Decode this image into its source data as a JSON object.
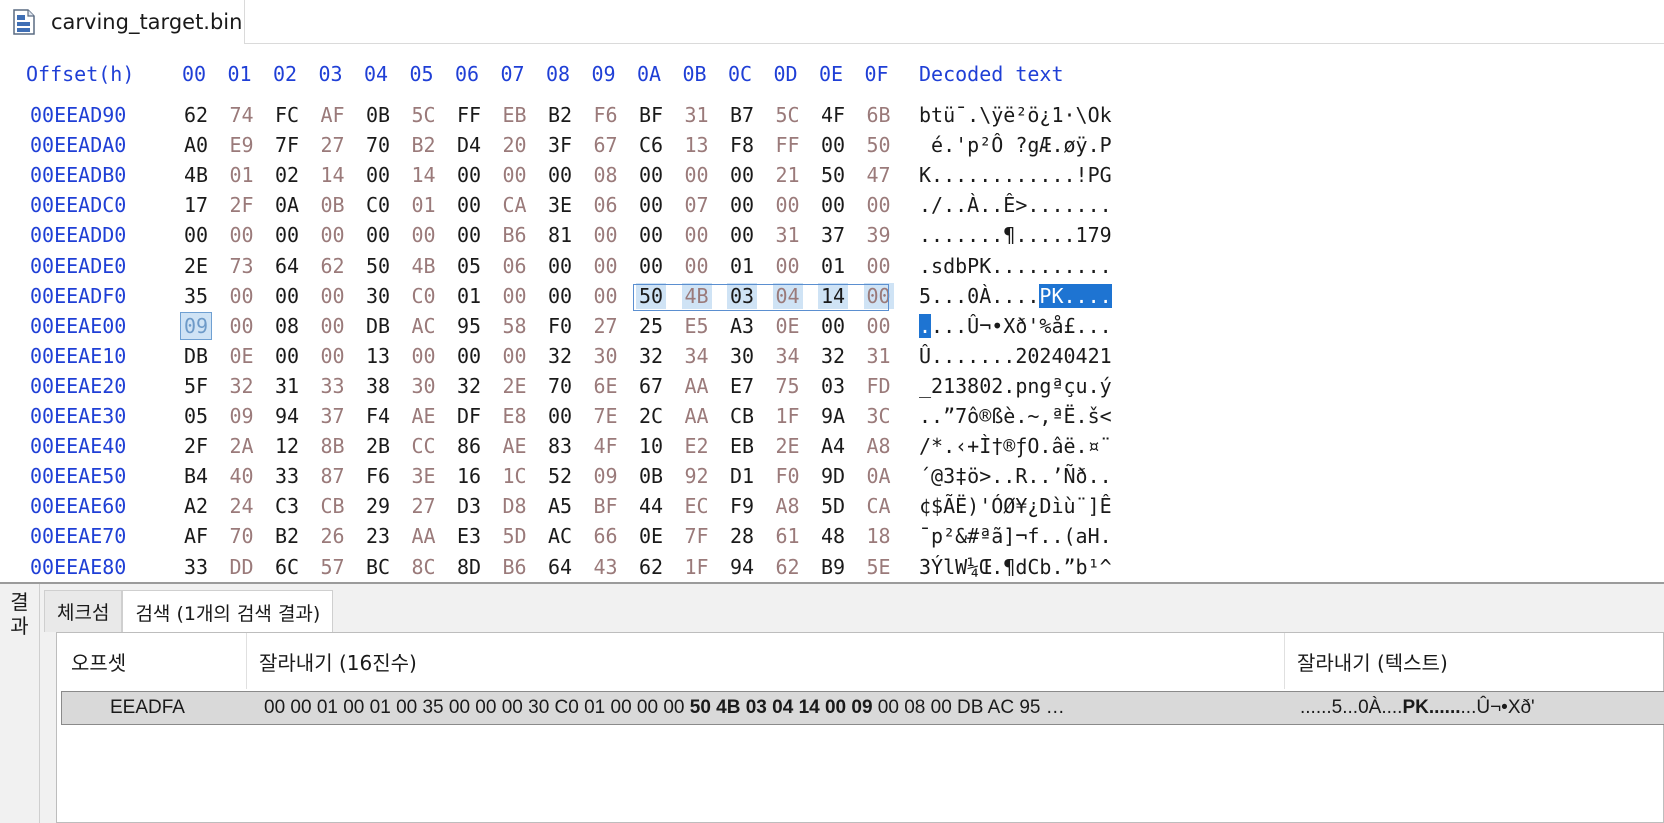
{
  "tab": {
    "filename": "carving_target.bin"
  },
  "hex": {
    "offset_header": "Offset(h)",
    "column_headers": [
      "00",
      "01",
      "02",
      "03",
      "04",
      "05",
      "06",
      "07",
      "08",
      "09",
      "0A",
      "0B",
      "0C",
      "0D",
      "0E",
      "0F"
    ],
    "decoded_header": "Decoded text",
    "rows": [
      {
        "offset": "00EEAD90",
        "bytes": [
          "62",
          "74",
          "FC",
          "AF",
          "0B",
          "5C",
          "FF",
          "EB",
          "B2",
          "F6",
          "BF",
          "31",
          "B7",
          "5C",
          "4F",
          "6B"
        ],
        "decoded": "btü¯.\\ÿë²ö¿1·\\Ok"
      },
      {
        "offset": "00EEADA0",
        "bytes": [
          "A0",
          "E9",
          "7F",
          "27",
          "70",
          "B2",
          "D4",
          "20",
          "3F",
          "67",
          "C6",
          "13",
          "F8",
          "FF",
          "00",
          "50"
        ],
        "decoded": " é.'p²Ô ?gÆ.øÿ.P"
      },
      {
        "offset": "00EEADB0",
        "bytes": [
          "4B",
          "01",
          "02",
          "14",
          "00",
          "14",
          "00",
          "00",
          "00",
          "08",
          "00",
          "00",
          "00",
          "21",
          "50",
          "47"
        ],
        "decoded": "K............!PG"
      },
      {
        "offset": "00EEADC0",
        "bytes": [
          "17",
          "2F",
          "0A",
          "0B",
          "C0",
          "01",
          "00",
          "CA",
          "3E",
          "06",
          "00",
          "07",
          "00",
          "00",
          "00",
          "00"
        ],
        "decoded": "./..À..Ê>......."
      },
      {
        "offset": "00EEADD0",
        "bytes": [
          "00",
          "00",
          "00",
          "00",
          "00",
          "00",
          "00",
          "B6",
          "81",
          "00",
          "00",
          "00",
          "00",
          "31",
          "37",
          "39"
        ],
        "decoded": ".......¶.....179"
      },
      {
        "offset": "00EEADE0",
        "bytes": [
          "2E",
          "73",
          "64",
          "62",
          "50",
          "4B",
          "05",
          "06",
          "00",
          "00",
          "00",
          "00",
          "01",
          "00",
          "01",
          "00"
        ],
        "decoded": ".sdbPK.........."
      },
      {
        "offset": "00EEADF0",
        "bytes": [
          "35",
          "00",
          "00",
          "00",
          "30",
          "C0",
          "01",
          "00",
          "00",
          "00",
          "50",
          "4B",
          "03",
          "04",
          "14",
          "00"
        ],
        "decoded": "5...0À....PK...."
      },
      {
        "offset": "00EEAE00",
        "bytes": [
          "09",
          "00",
          "08",
          "00",
          "DB",
          "AC",
          "95",
          "58",
          "F0",
          "27",
          "25",
          "E5",
          "A3",
          "0E",
          "00",
          "00"
        ],
        "decoded": "....Û¬•Xð'%å£..."
      },
      {
        "offset": "00EEAE10",
        "bytes": [
          "DB",
          "0E",
          "00",
          "00",
          "13",
          "00",
          "00",
          "00",
          "32",
          "30",
          "32",
          "34",
          "30",
          "34",
          "32",
          "31"
        ],
        "decoded": "Û.......20240421"
      },
      {
        "offset": "00EEAE20",
        "bytes": [
          "5F",
          "32",
          "31",
          "33",
          "38",
          "30",
          "32",
          "2E",
          "70",
          "6E",
          "67",
          "AA",
          "E7",
          "75",
          "03",
          "FD"
        ],
        "decoded": "_213802.pngªçu.ý"
      },
      {
        "offset": "00EEAE30",
        "bytes": [
          "05",
          "09",
          "94",
          "37",
          "F4",
          "AE",
          "DF",
          "E8",
          "00",
          "7E",
          "2C",
          "AA",
          "CB",
          "1F",
          "9A",
          "3C"
        ],
        "decoded": "..”7ô®ßè.~,ªË.š<"
      },
      {
        "offset": "00EEAE40",
        "bytes": [
          "2F",
          "2A",
          "12",
          "8B",
          "2B",
          "CC",
          "86",
          "AE",
          "83",
          "4F",
          "10",
          "E2",
          "EB",
          "2E",
          "A4",
          "A8"
        ],
        "decoded": "/*.‹+Ì†®ƒO.âë.¤¨"
      },
      {
        "offset": "00EEAE50",
        "bytes": [
          "B4",
          "40",
          "33",
          "87",
          "F6",
          "3E",
          "16",
          "1C",
          "52",
          "09",
          "0B",
          "92",
          "D1",
          "F0",
          "9D",
          "0A"
        ],
        "decoded": "´@3‡ö>..R..’Ñð.."
      },
      {
        "offset": "00EEAE60",
        "bytes": [
          "A2",
          "24",
          "C3",
          "CB",
          "29",
          "27",
          "D3",
          "D8",
          "A5",
          "BF",
          "44",
          "EC",
          "F9",
          "A8",
          "5D",
          "CA"
        ],
        "decoded": "¢$ÃË)'ÓØ¥¿Dìù¨]Ê"
      },
      {
        "offset": "00EEAE70",
        "bytes": [
          "AF",
          "70",
          "B2",
          "26",
          "23",
          "AA",
          "E3",
          "5D",
          "AC",
          "66",
          "0E",
          "7F",
          "28",
          "61",
          "48",
          "18"
        ],
        "decoded": "¯p²&#ªã]¬f..(aH."
      },
      {
        "offset": "00EEAE80",
        "bytes": [
          "33",
          "DD",
          "6C",
          "57",
          "BC",
          "8C",
          "8D",
          "B6",
          "64",
          "43",
          "62",
          "1F",
          "94",
          "62",
          "B9",
          "5E"
        ],
        "decoded": "3ÝlW¼Œ.¶dCb.”b¹^"
      }
    ]
  },
  "results_pane": {
    "side_label": [
      "결",
      "과"
    ],
    "tabs": [
      {
        "label": "체크섬",
        "active": false
      },
      {
        "label": "검색 (1개의 검색 결과)",
        "active": true
      }
    ],
    "columns": [
      "오프셋",
      "잘라내기 (16진수)",
      "잘라내기 (텍스트)"
    ],
    "rows": [
      {
        "offset": "EEADFA",
        "hex_before": "00 00 01 00 01 00 35 00 00 00 30 C0 01 00 00 00 ",
        "hex_match": "50 4B 03 04 14 00 09",
        "hex_after": " 00 08 00 DB AC 95 …",
        "text_before": "......5...0À....",
        "text_match": "PK......",
        "text_after": "...Û¬•Xð'"
      }
    ]
  }
}
